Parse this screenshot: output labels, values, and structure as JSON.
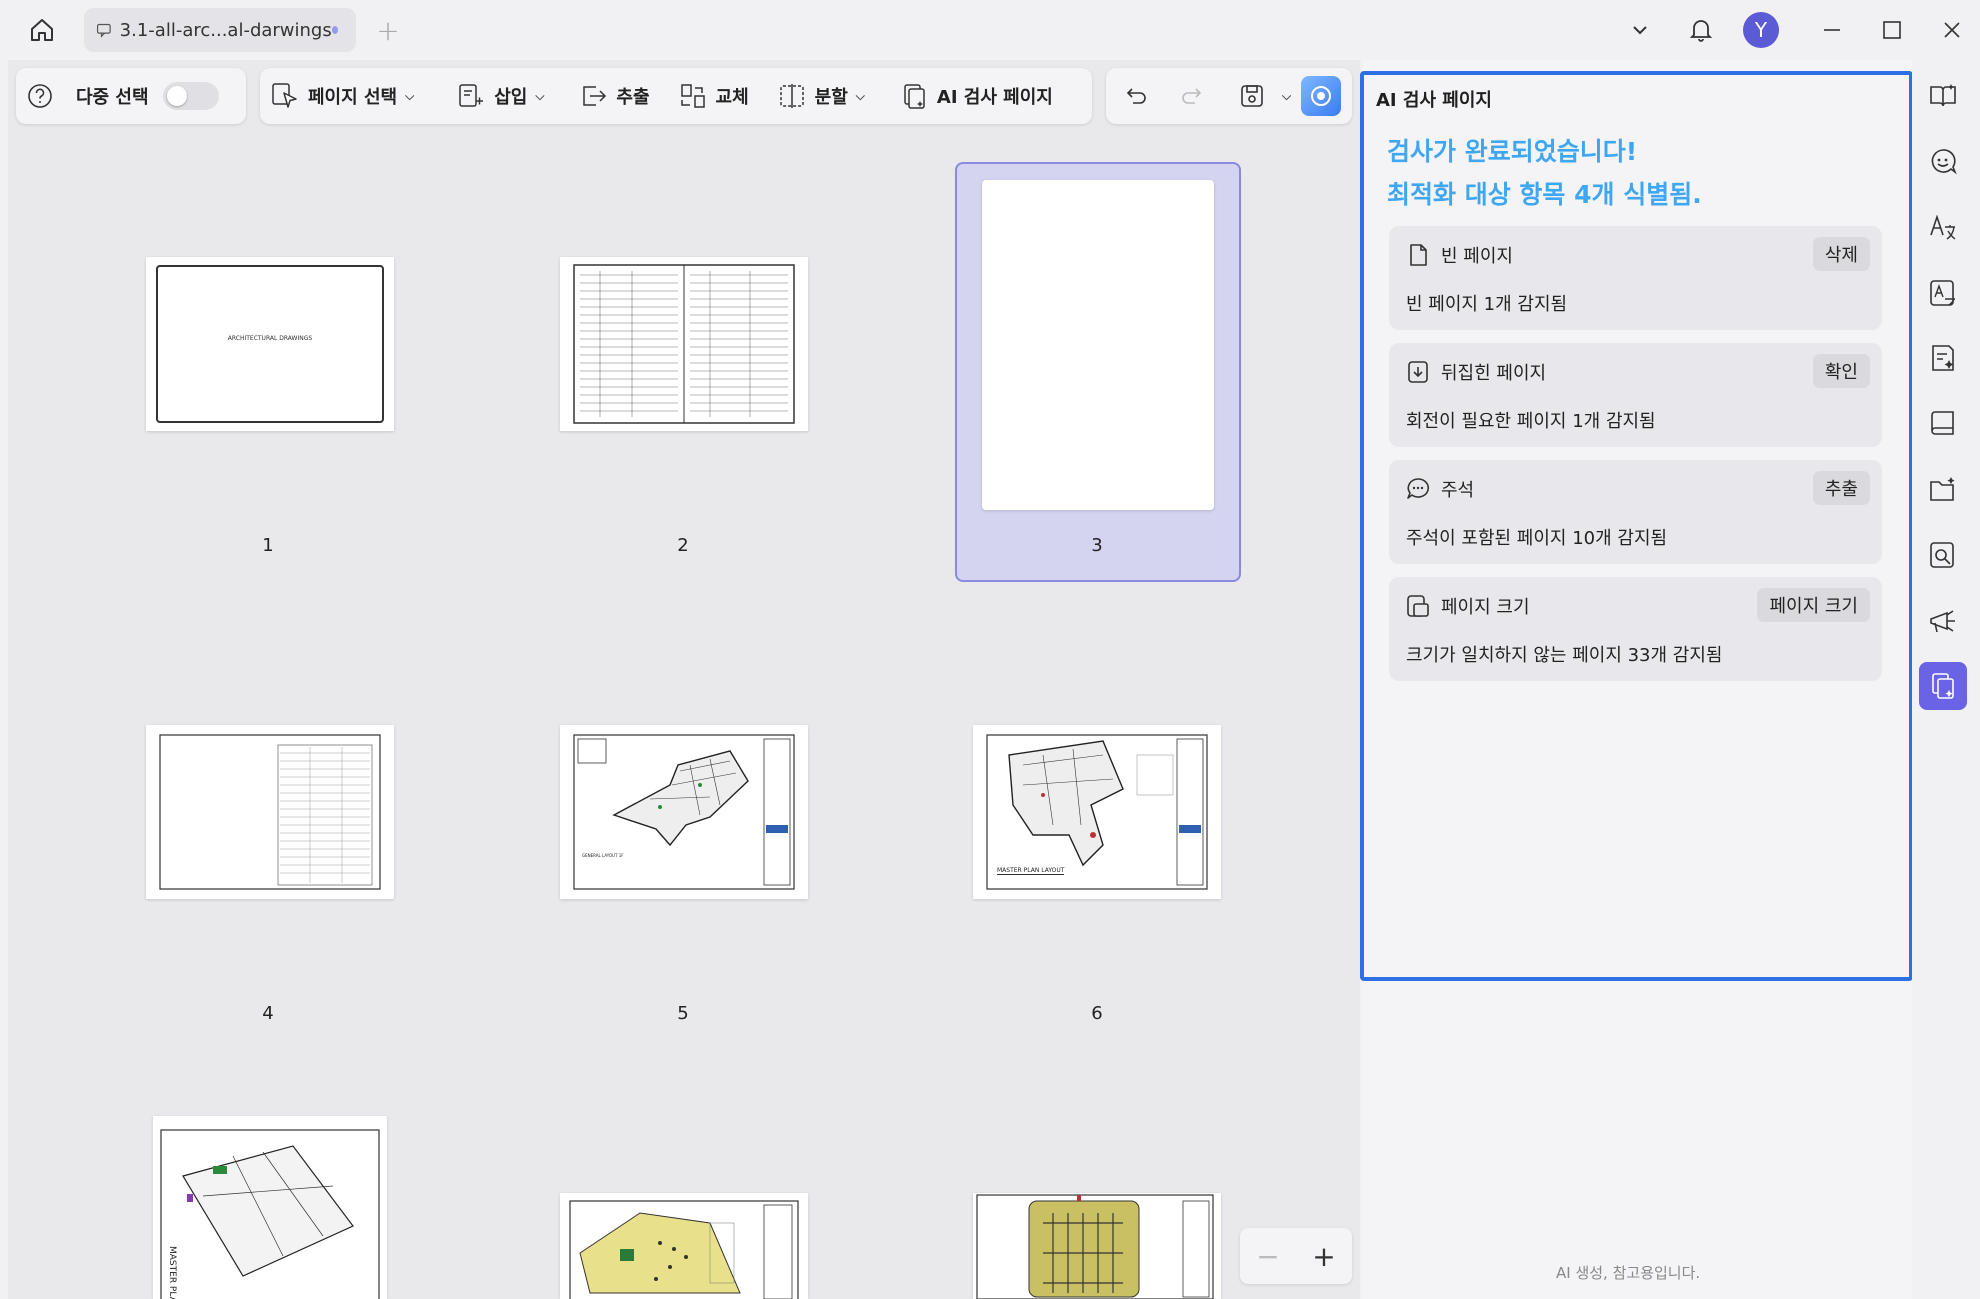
{
  "tab": {
    "title": "3.1-all-arc...al-darwings"
  },
  "toolbar": {
    "multi_select": "다중 선택",
    "page_select": "페이지 선택",
    "insert": "삽입",
    "extract": "추출",
    "replace": "교체",
    "split": "분할",
    "ai_check": "AI 검사 페이지"
  },
  "avatar_letter": "Y",
  "pages": [
    {
      "num": "1"
    },
    {
      "num": "2"
    },
    {
      "num": "3"
    },
    {
      "num": "4"
    },
    {
      "num": "5"
    },
    {
      "num": "6"
    }
  ],
  "thumb_text": {
    "p1": "ARCHITECTURAL DRAWINGS",
    "p5": "GENERAL LAYOUT 1F",
    "p6": "MASTER PLAN LAYOUT",
    "p7": "MASTER PLAN"
  },
  "zoom": {
    "minus": "−",
    "plus": "+"
  },
  "panel": {
    "title": "AI 검사 페이지",
    "headline1": "검사가 완료되었습니다!",
    "headline2": "최적화 대상 항목 4개 식별됨.",
    "cards": [
      {
        "title": "빈 페이지",
        "button": "삭제",
        "desc": "빈 페이지 1개 감지됨"
      },
      {
        "title": "뒤집힌 페이지",
        "button": "확인",
        "desc": "회전이 필요한 페이지 1개 감지됨"
      },
      {
        "title": "주석",
        "button": "추출",
        "desc": "주석이 포함된 페이지 10개 감지됨"
      },
      {
        "title": "페이지 크기",
        "button": "페이지 크기",
        "desc": "크기가 일치하지 않는 페이지 33개 감지됨"
      }
    ],
    "footer": "AI 생성, 참고용입니다."
  },
  "colors": {
    "accent": "#2f6fe6",
    "headline": "#3fa7f2",
    "selected": "#d4d4f0",
    "rail_active": "#6a63e6"
  }
}
